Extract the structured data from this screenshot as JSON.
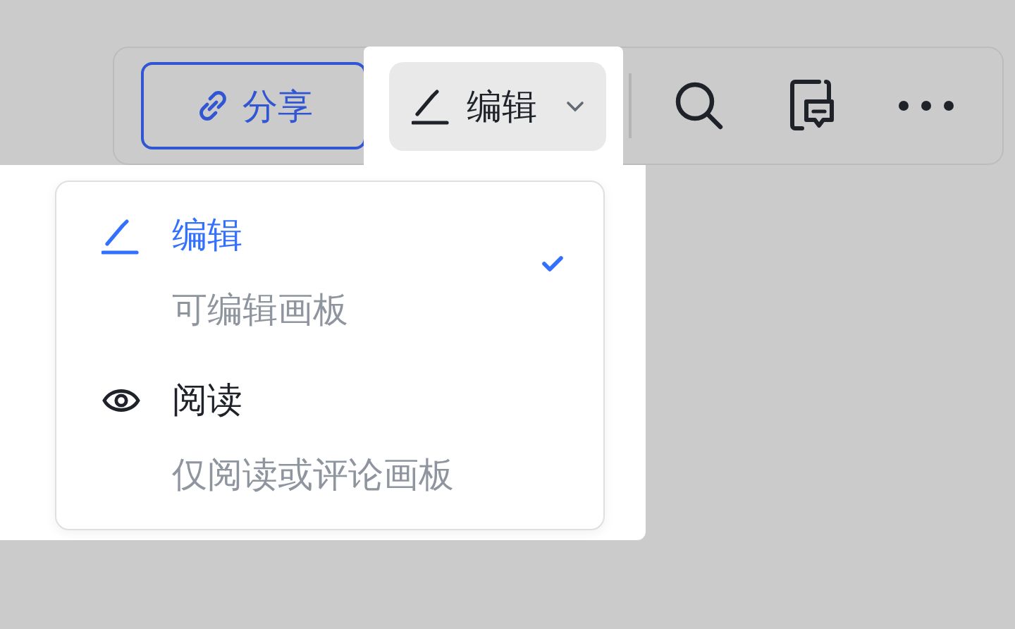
{
  "toolbar": {
    "share_button": {
      "label": "分享"
    },
    "mode_button": {
      "label": "编辑"
    }
  },
  "menu": {
    "items": [
      {
        "kind": "edit",
        "label": "编辑",
        "description": "可编辑画板",
        "selected": true
      },
      {
        "kind": "read",
        "label": "阅读",
        "description": "仅阅读或评论画板",
        "selected": false
      }
    ]
  }
}
